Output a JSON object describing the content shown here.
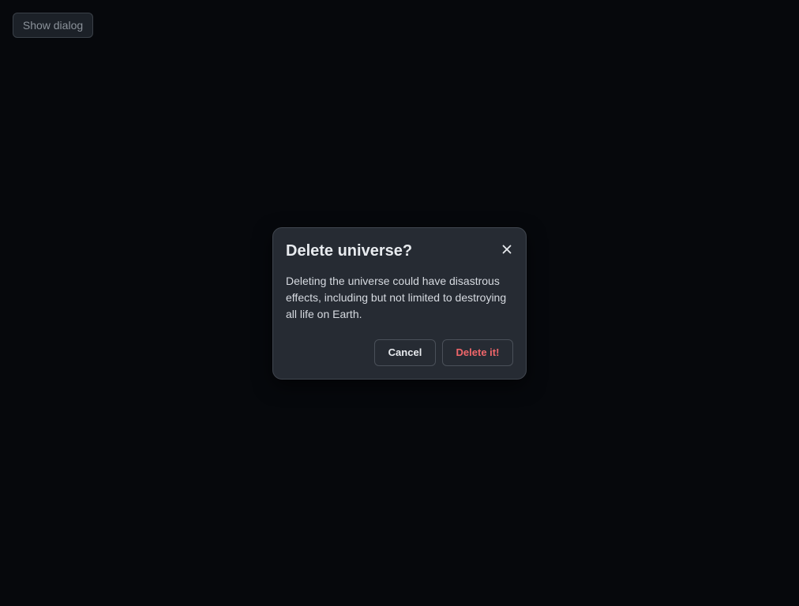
{
  "page": {
    "show_dialog_label": "Show dialog"
  },
  "dialog": {
    "title": "Delete universe?",
    "body": "Deleting the universe could have disastrous effects, including but not limited to destroying all life on Earth.",
    "cancel_label": "Cancel",
    "delete_label": "Delete it!",
    "close_icon": "close-icon"
  },
  "colors": {
    "background": "#06080c",
    "dialog_bg": "#262b33",
    "danger": "#f0666a"
  }
}
